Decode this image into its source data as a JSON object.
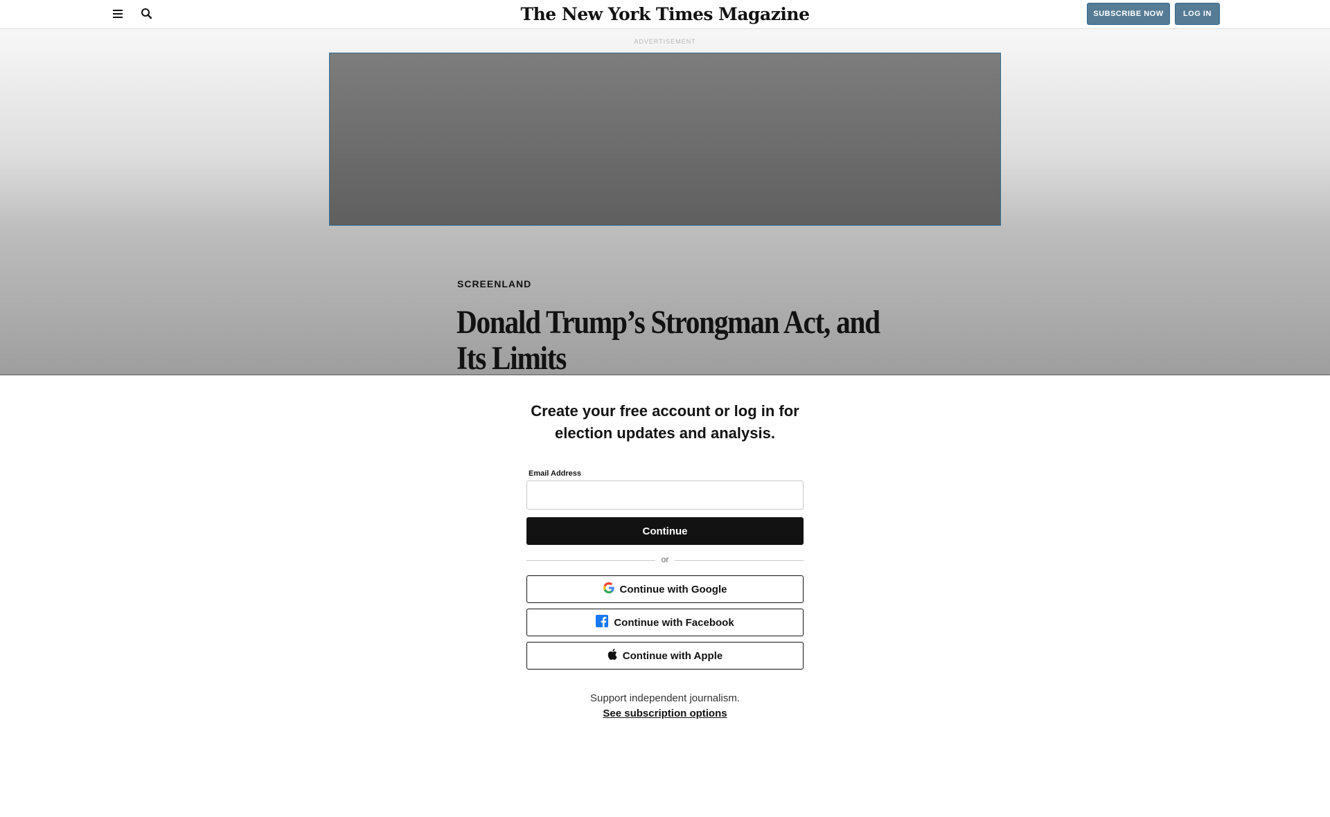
{
  "header": {
    "logo": "The New York Times Magazine",
    "subscribe_label": "SUBSCRIBE NOW",
    "login_label": "LOG IN",
    "menu_icon": "menu-icon",
    "search_icon": "search-icon",
    "button_color": "#567b95"
  },
  "article": {
    "ad_label": "ADVERTISEMENT",
    "kicker": "SCREENLAND",
    "headline": "Donald Trump’s Strongman Act, and Its Limits"
  },
  "login": {
    "title": "Create your free account or log in for election updates and analysis.",
    "email_label": "Email Address",
    "email_value": "",
    "continue_label": "Continue",
    "or_label": "or",
    "google_label": "Continue with Google",
    "facebook_label": "Continue with Facebook",
    "apple_label": "Continue with Apple",
    "support_text": "Support independent journalism.",
    "subscription_link": "See subscription options"
  }
}
